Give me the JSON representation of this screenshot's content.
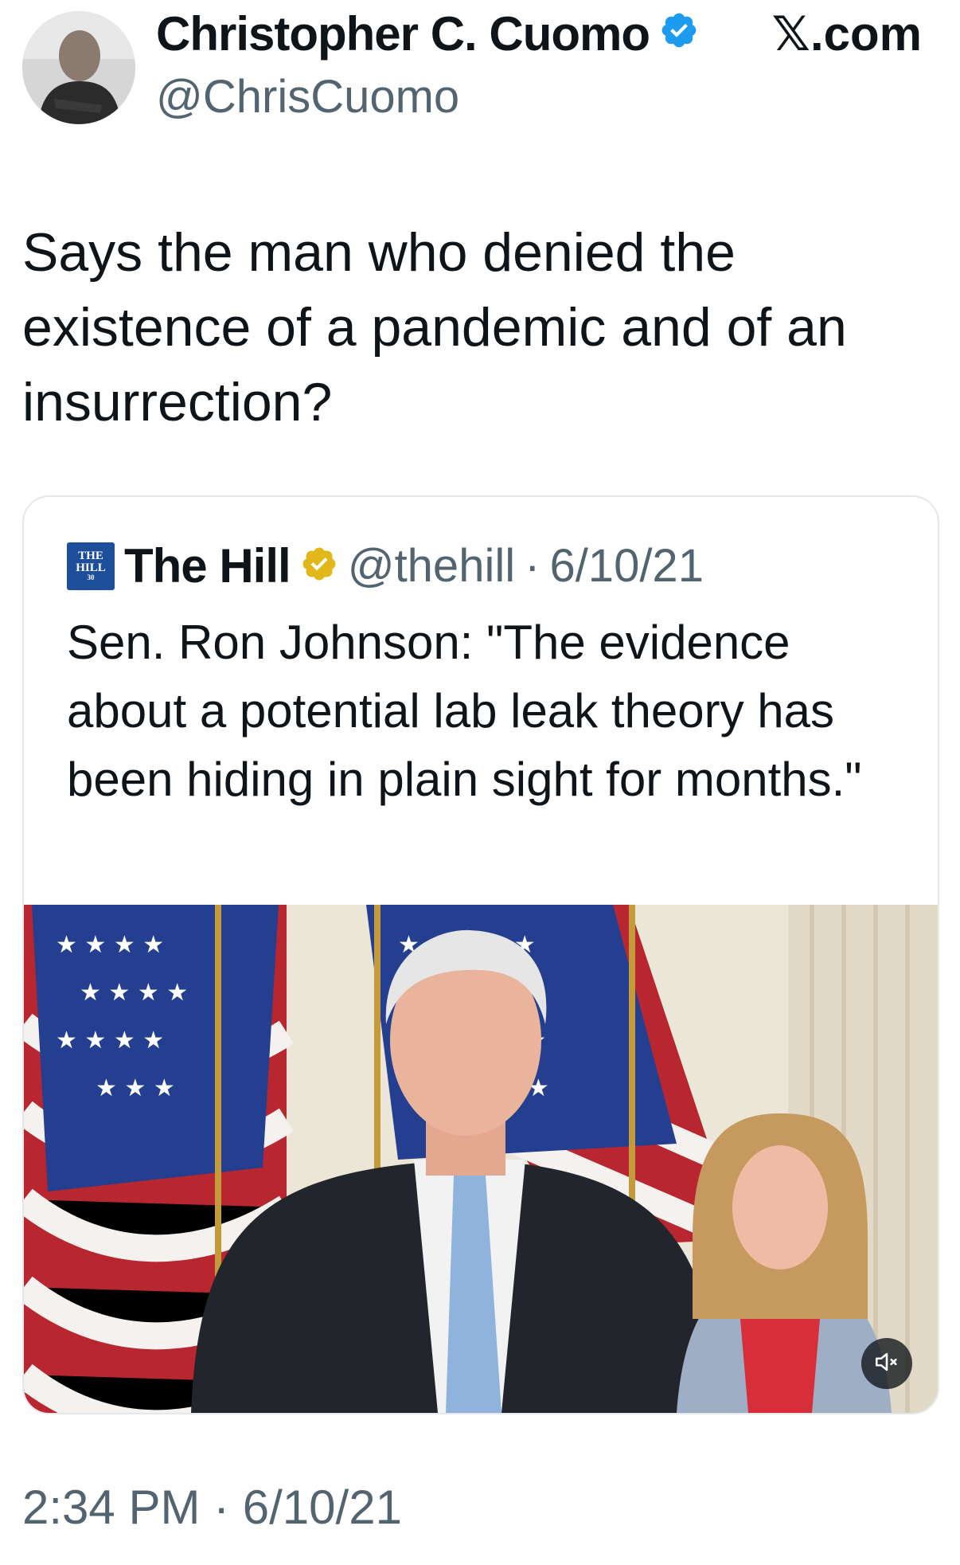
{
  "author": {
    "display_name": "Christopher C. Cuomo",
    "handle": "@ChrisCuomo",
    "verified_icon": "verified-badge-icon"
  },
  "site_label": "𝕏.com",
  "tweet": {
    "text": "Says the man who denied the existence of a pandemic and of an insurrection?",
    "timestamp": "2:34 PM · 6/10/21"
  },
  "quote": {
    "logo_text": "THE HILL",
    "name": "The Hill",
    "handle": "@thehill",
    "separator": "·",
    "date": "6/10/21",
    "text": "Sen. Ron Johnson: \"The evidence about a potential lab leak theory has been hiding in plain sight for months.\"",
    "media_icon": "mute-icon"
  },
  "colors": {
    "text": "#0f1419",
    "secondary": "#536471",
    "verified_blue": "#1d9bf0",
    "verified_gold": "#e2b719",
    "border": "#e4e8eb"
  }
}
